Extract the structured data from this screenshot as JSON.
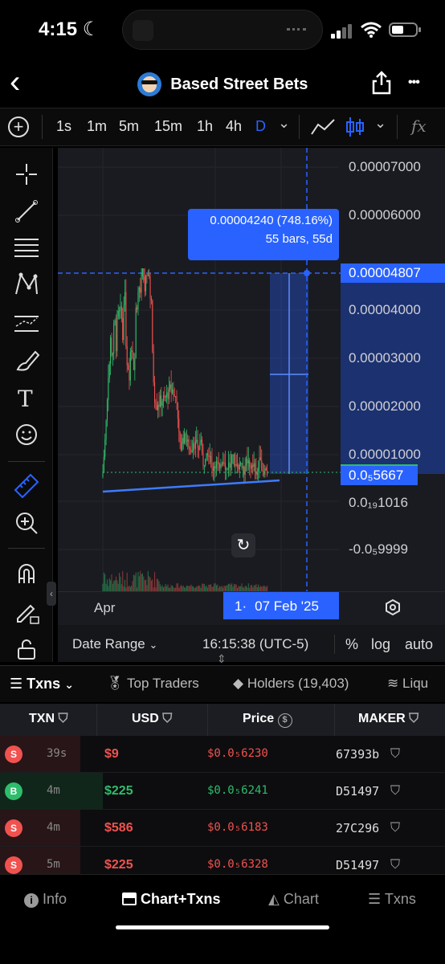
{
  "status": {
    "time": "4:15",
    "moon": "☾"
  },
  "header": {
    "back": "‹",
    "title": "Based Street Bets",
    "share": "⇪",
    "more": "•••"
  },
  "toolbar": {
    "add": "+",
    "timeframes": [
      "1s",
      "1m",
      "5m",
      "15m",
      "1h",
      "4h",
      "D"
    ],
    "active_timeframe": "D",
    "dropdown": "⌄",
    "fx": "fx"
  },
  "chart": {
    "y_labels": [
      "0.00007000",
      "0.00006000",
      "0.00004000",
      "0.00003000",
      "0.00002000",
      "0.00001000",
      "0.0₁₉1016",
      "-0.0₅9999"
    ],
    "price_tag_high": "0.00004807",
    "price_tag_current": "0.0₅5667",
    "measure_line1": "0.00004240 (748.16%)",
    "measure_line2": "55 bars, 55d",
    "x_label": "Apr",
    "x_date_prefix": "1·",
    "x_date": "07 Feb '25",
    "reset_icon": "↻"
  },
  "range_bar": {
    "date_range": "Date Range",
    "clock": "16:15:38 (UTC-5)",
    "percent": "%",
    "log": "log",
    "auto": "auto"
  },
  "tabs": {
    "txns": "Txns",
    "top_traders": "Top Traders",
    "holders": "Holders (19,403)",
    "liquidity": "Liqu"
  },
  "table": {
    "headers": {
      "txn": "TXN",
      "usd": "USD",
      "price": "Price",
      "maker": "MAKER"
    },
    "rows": [
      {
        "type": "S",
        "age": "39s",
        "usd": "$9",
        "price": "$0.0₅6230",
        "maker": "67393b"
      },
      {
        "type": "B",
        "age": "4m",
        "usd": "$225",
        "price": "$0.0₅6241",
        "maker": "D51497"
      },
      {
        "type": "S",
        "age": "4m",
        "usd": "$586",
        "price": "$0.0₅6183",
        "maker": "27C296"
      },
      {
        "type": "S",
        "age": "5m",
        "usd": "$225",
        "price": "$0.0₅6328",
        "maker": "D51497"
      }
    ]
  },
  "bottom_nav": {
    "info": "Info",
    "chart_txns": "Chart+Txns",
    "chart": "Chart",
    "txns": "Txns"
  },
  "colors": {
    "accent": "#2962ff",
    "buy": "#2ebd6b",
    "sell": "#f0524f",
    "panel": "#1a1b20"
  }
}
